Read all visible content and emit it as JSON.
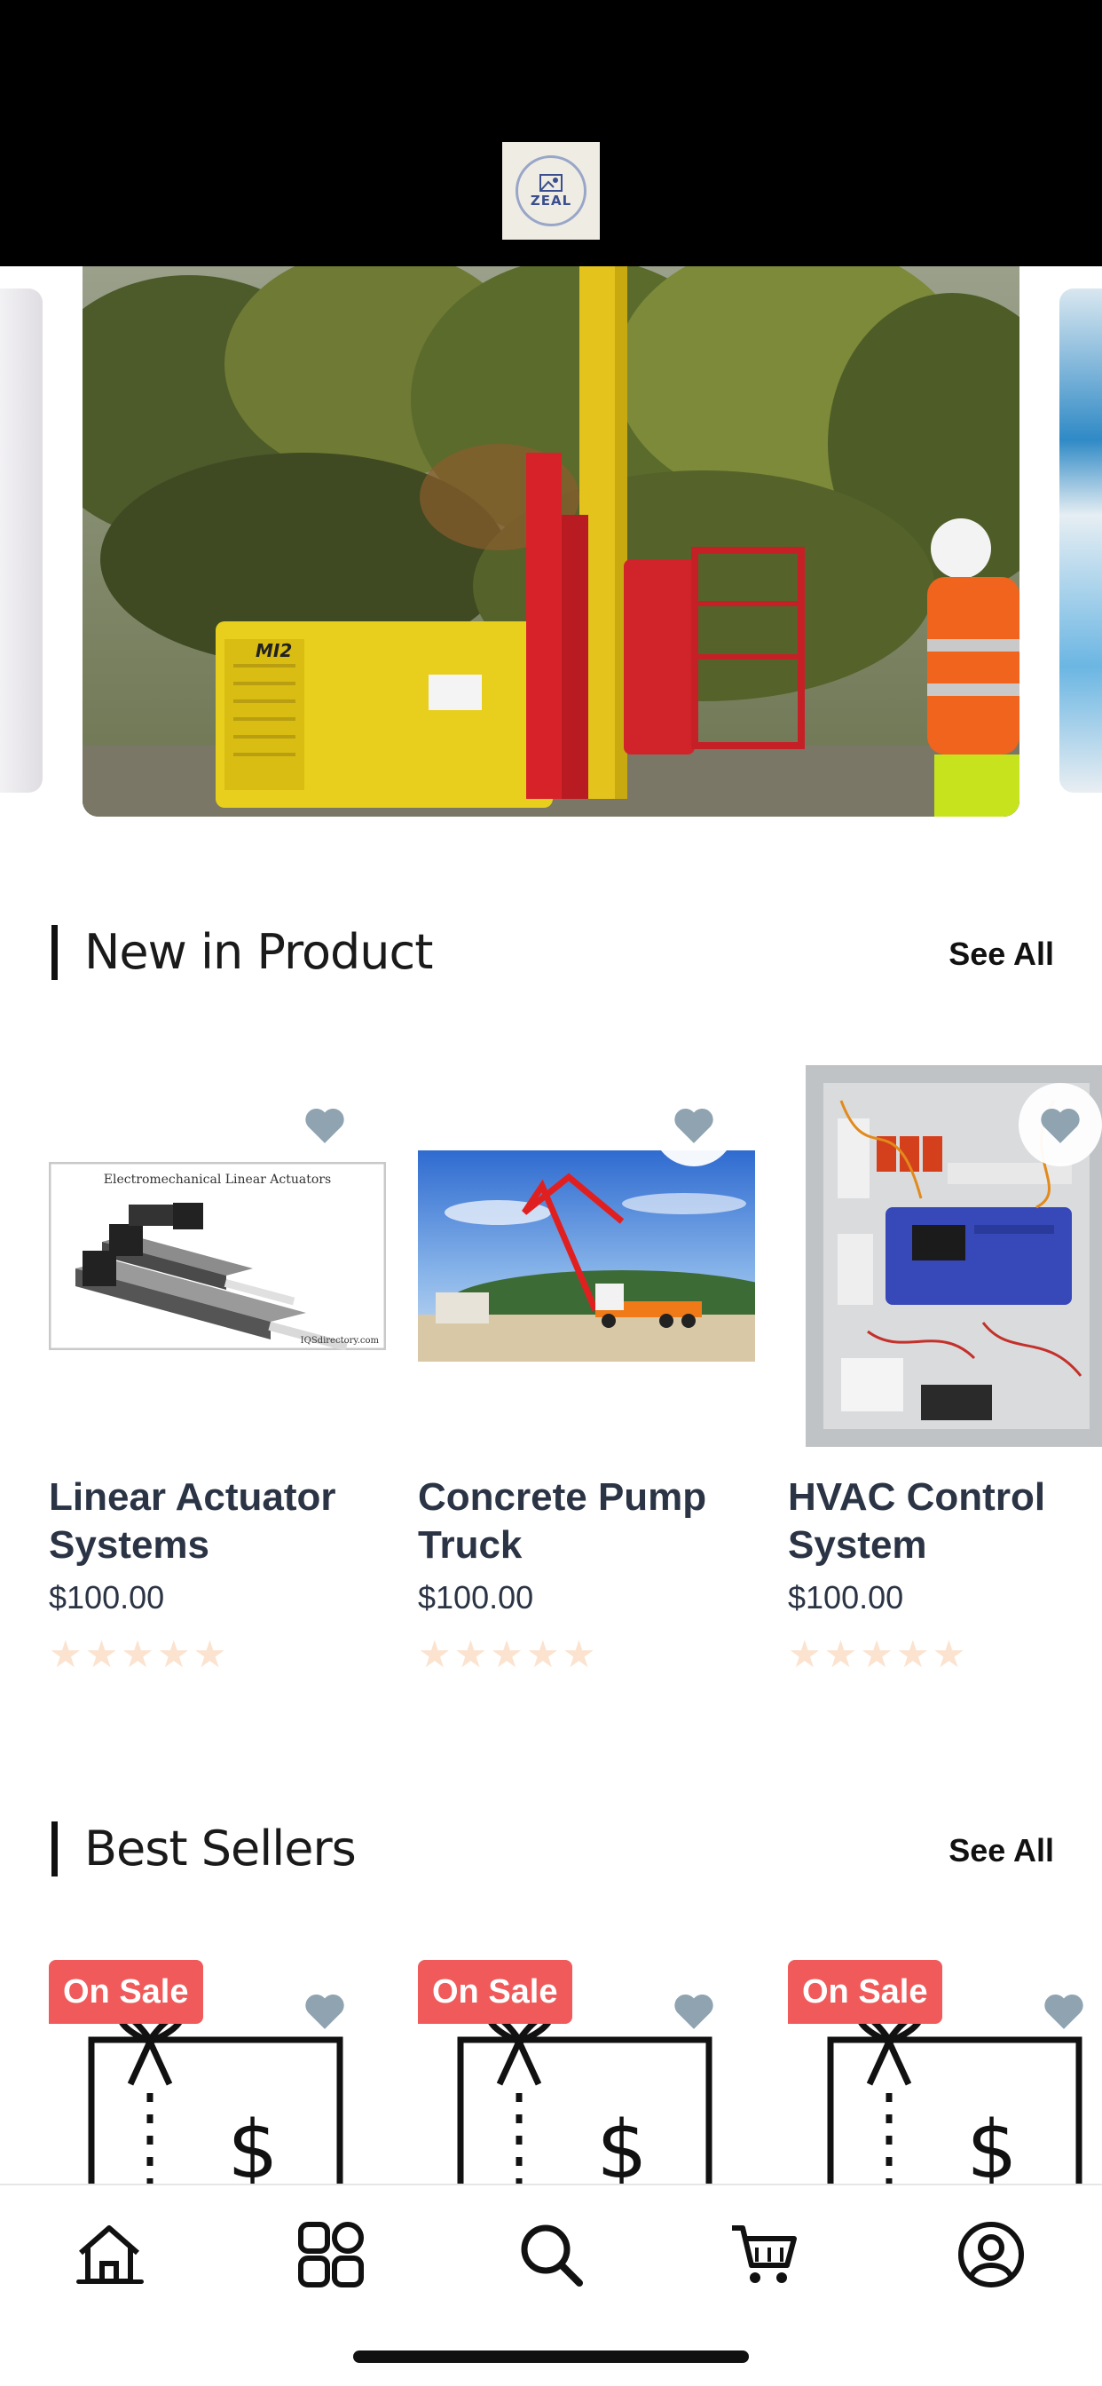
{
  "header": {
    "logo_text": "ZEAL"
  },
  "sections": {
    "new_products": {
      "title": "New in Product",
      "see_all": "See All"
    },
    "best_sellers": {
      "title": "Best Sellers",
      "see_all": "See All"
    }
  },
  "products": [
    {
      "title": "Linear Actuator Systems",
      "price": "$100.00",
      "stars": "★★★★★",
      "image_caption": "Electromechanical Linear Actuators",
      "image_credit": "IQSdirectory.com"
    },
    {
      "title": "Concrete Pump Truck",
      "price": "$100.00",
      "stars": "★★★★★"
    },
    {
      "title": "HVAC Control System",
      "price": "$100.00",
      "stars": "★★★★★"
    }
  ],
  "best_sellers": [
    {
      "badge": "On Sale",
      "symbol": "$"
    },
    {
      "badge": "On Sale",
      "symbol": "$"
    },
    {
      "badge": "On Sale",
      "symbol": "$"
    }
  ],
  "banner": {
    "machine_label": "MI2"
  },
  "colors": {
    "header_bg": "#000000",
    "sale_badge": "#f05a5a",
    "heart": "#8fa3b1",
    "star_inactive": "#fbe3cf",
    "text_dark": "#2b3445"
  },
  "nav": [
    {
      "name": "home-icon",
      "active": true
    },
    {
      "name": "categories-icon",
      "active": false
    },
    {
      "name": "search-icon",
      "active": false
    },
    {
      "name": "cart-icon",
      "active": false
    },
    {
      "name": "profile-icon",
      "active": false
    }
  ]
}
